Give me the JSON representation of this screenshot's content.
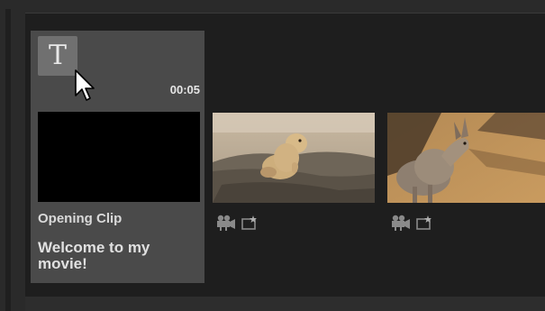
{
  "title_clip": {
    "icon_letter": "T",
    "duration": "00:05",
    "label": "Opening Clip",
    "caption": "Welcome to my movie!"
  },
  "video_clips": [
    {
      "subject": "prairie dog on dirt mound",
      "icons": [
        "film-camera-icon",
        "transition-star-icon"
      ]
    },
    {
      "subject": "wallaby on sandy ground",
      "icons": [
        "film-camera-icon",
        "transition-star-icon"
      ]
    }
  ],
  "colors": {
    "panel": "#1e1e1e",
    "selected_clip": "#4a4a4a",
    "icon_bg": "#707070"
  }
}
